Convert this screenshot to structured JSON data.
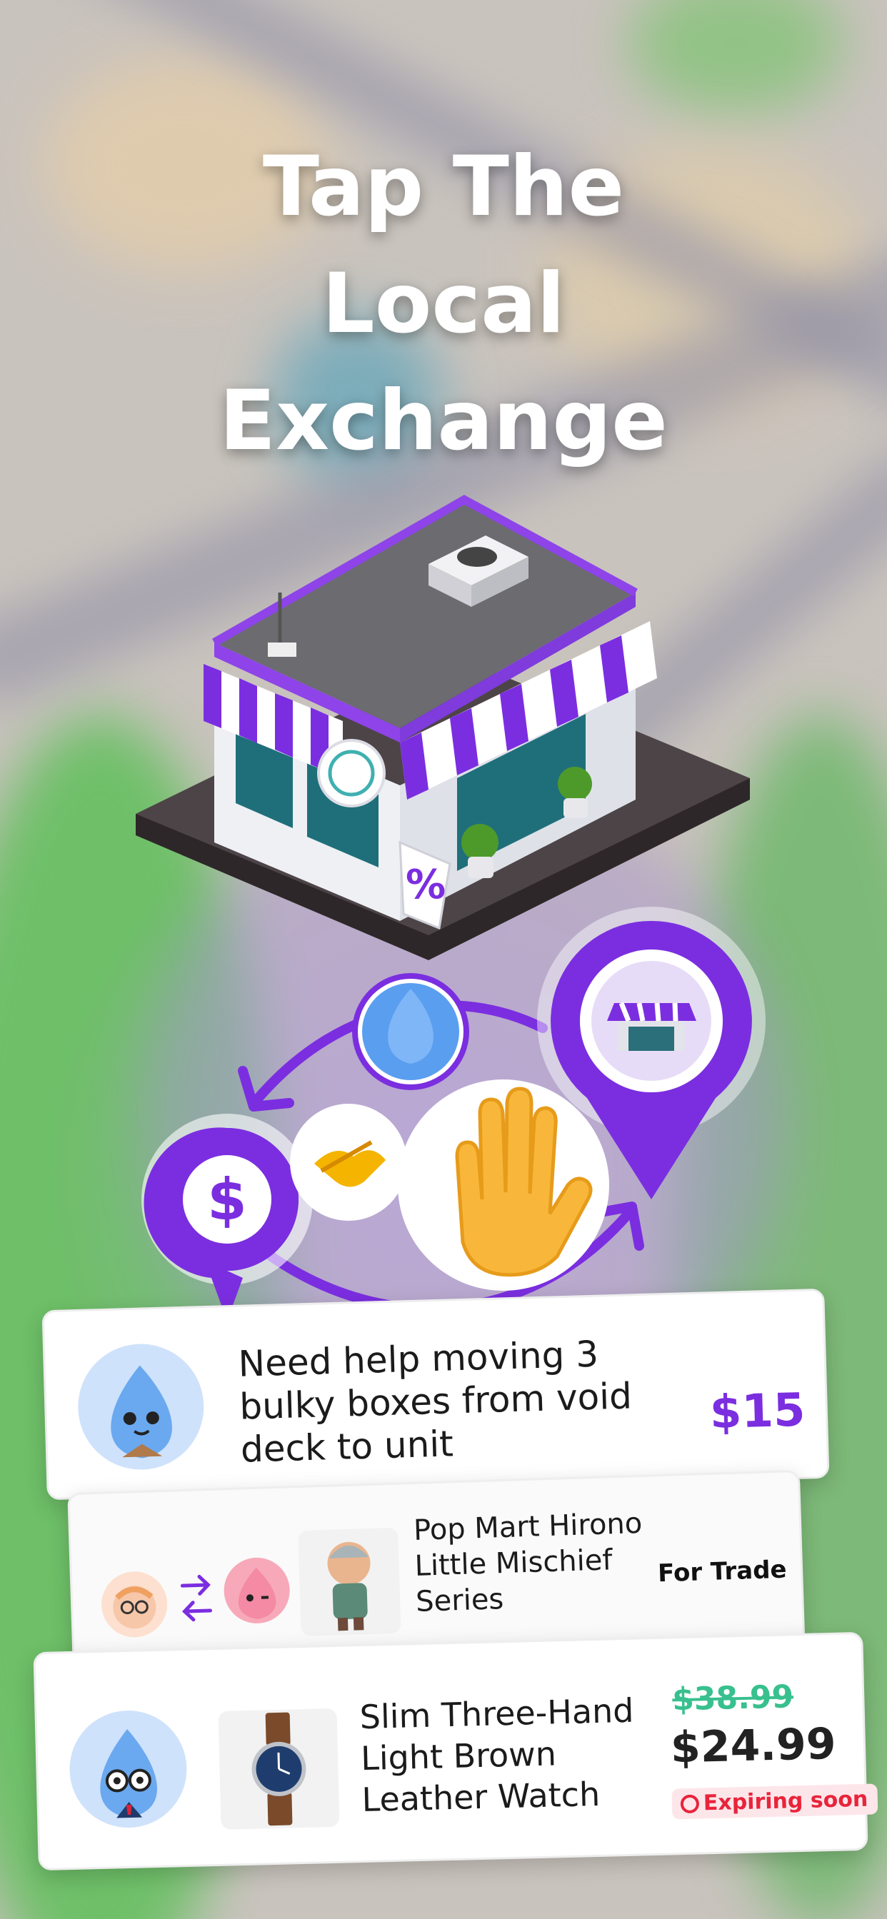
{
  "headline": {
    "line1": "Tap The",
    "line2": "Local",
    "line3": "Exchange"
  },
  "store_icons": {
    "sign_symbol": "%",
    "dollar_symbol": "$"
  },
  "colors": {
    "accent": "#7b2ee0",
    "price_old": "#38c08e",
    "expiring": "#e8243b"
  },
  "cards": [
    {
      "text": "Need help moving 3 bulky boxes from void deck to unit",
      "price": "$15"
    },
    {
      "title": "Pop Mart Hirono Little Mischief Series",
      "tag": "For Trade"
    },
    {
      "title": "Slim Three-Hand Light Brown Leather Watch",
      "old_price": "$38.99",
      "new_price": "$24.99",
      "badge": "Expiring soon"
    }
  ]
}
